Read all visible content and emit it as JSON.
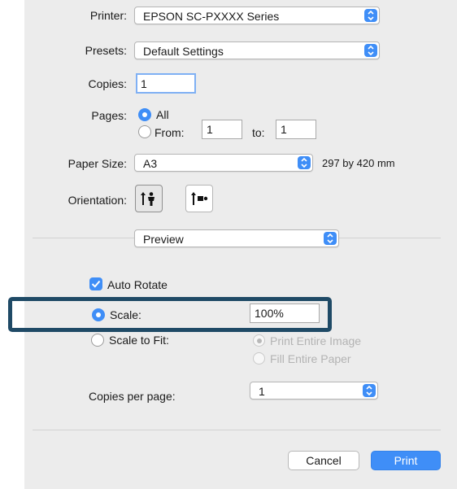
{
  "printer": {
    "label": "Printer:",
    "value": "EPSON SC-PXXXX Series"
  },
  "presets": {
    "label": "Presets:",
    "value": "Default Settings"
  },
  "copies": {
    "label": "Copies:",
    "value": "1"
  },
  "pages": {
    "label": "Pages:",
    "all_label": "All",
    "from_label": "From:",
    "from_value": "1",
    "to_label": "to:",
    "to_value": "1",
    "selected": "All"
  },
  "paper_size": {
    "label": "Paper Size:",
    "value": "A3",
    "dimensions": "297 by 420 mm"
  },
  "orientation": {
    "label": "Orientation:",
    "options": [
      "portrait-icon",
      "landscape-icon"
    ],
    "selected": "portrait-icon"
  },
  "section": {
    "value": "Preview"
  },
  "preview": {
    "auto_rotate_label": "Auto Rotate",
    "auto_rotate_checked": true,
    "scale_label": "Scale:",
    "scale_value": "100%",
    "scale_to_fit_label": "Scale to Fit:",
    "print_entire_image_label": "Print Entire Image",
    "fill_entire_paper_label": "Fill Entire Paper",
    "copies_per_page_label": "Copies per page:",
    "copies_per_page_value": "1"
  },
  "buttons": {
    "cancel": "Cancel",
    "print": "Print"
  },
  "colors": {
    "accent": "#3f8ef7",
    "highlight_border": "#1f4a66",
    "dialog_bg": "#ececec"
  }
}
